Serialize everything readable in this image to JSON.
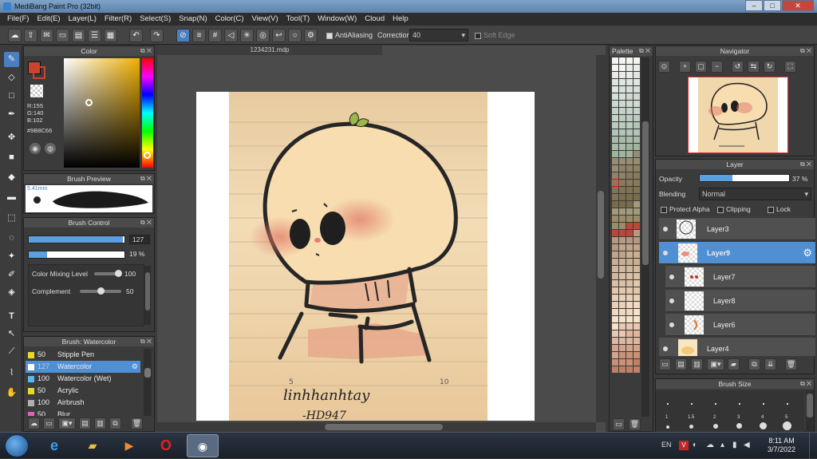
{
  "window": {
    "title": "MediBang Paint Pro (32bit)",
    "buttons": [
      "–",
      "□",
      "✕"
    ]
  },
  "menu": [
    "File(F)",
    "Edit(E)",
    "Layer(L)",
    "Filter(R)",
    "Select(S)",
    "Snap(N)",
    "Color(C)",
    "View(V)",
    "Tool(T)",
    "Window(W)",
    "Cloud",
    "Help"
  ],
  "toolbar": {
    "antialiasing_label": "AntiAliasing",
    "correction_label": "Correction",
    "correction_value": "40",
    "soft_edge_label": "Soft Edge"
  },
  "color_panel": {
    "title": "Color",
    "r": "R:155",
    "g": "G:140",
    "b": "B:102",
    "hex": "#9B8C66",
    "accent": "#c8452f"
  },
  "brush_preview": {
    "title": "Brush Preview",
    "size_label": "5.41mm"
  },
  "brush_control": {
    "title": "Brush Control",
    "size_value": "127",
    "size_fraction": 0.98,
    "opacity_value": "19 %",
    "opacity_fraction": 0.19,
    "mixing_label": "Color Mixing Level",
    "mixing_value": "100",
    "complement_label": "Complement",
    "complement_value": "50"
  },
  "brush_list": {
    "title": "Brush: Watercolor",
    "items": [
      {
        "size": "50",
        "name": "Stipple Pen",
        "color": "#e8d82a"
      },
      {
        "size": "127",
        "name": "Watercolor",
        "color": "#ffffff"
      },
      {
        "size": "100",
        "name": "Watercolor (Wet)",
        "color": "#5ab8f0"
      },
      {
        "size": "50",
        "name": "Acrylic",
        "color": "#e8d82a"
      },
      {
        "size": "100",
        "name": "Airbrush",
        "color": "#b0b0b0"
      },
      {
        "size": "50",
        "name": "Blur",
        "color": "#e060c0"
      }
    ]
  },
  "document": {
    "tab_title": "1234231.mdp",
    "handwriting_1": "linhhanhtay",
    "handwriting_2": "-HD947",
    "ruler_label": "10",
    "ruler_label_2": "5"
  },
  "palette": {
    "title": "Palette"
  },
  "navigator": {
    "title": "Navigator"
  },
  "layer_panel": {
    "title": "Layer",
    "opacity_label": "Opacity",
    "opacity_value": "37 %",
    "opacity_fraction": 0.37,
    "blending_label": "Blending",
    "blending_value": "Normal",
    "protect_alpha_label": "Protect Alpha",
    "clipping_label": "Clipping",
    "lock_label": "Lock",
    "layers": [
      {
        "name": "Layer3",
        "selected": false
      },
      {
        "name": "Layer9",
        "selected": true
      },
      {
        "name": "Layer7",
        "selected": false
      },
      {
        "name": "Layer8",
        "selected": false
      },
      {
        "name": "Layer6",
        "selected": false
      },
      {
        "name": "Layer4",
        "selected": false
      }
    ]
  },
  "brush_size_panel": {
    "title": "Brush Size",
    "sizes": [
      "1",
      "1.5",
      "2",
      "3",
      "4",
      "5"
    ]
  },
  "taskbar": {
    "language": "EN",
    "time": "8:11 AM",
    "date": "3/7/2022"
  }
}
